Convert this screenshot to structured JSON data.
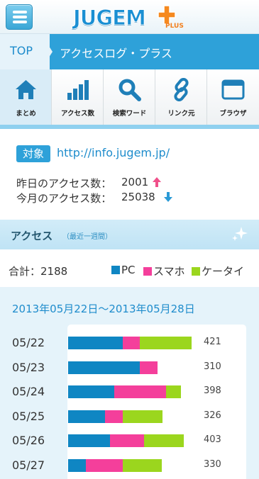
{
  "header": {
    "logo_text": "JUGEM",
    "logo_plus": "PLUS"
  },
  "breadcrumb": {
    "top": "TOP",
    "current": "アクセスログ・プラス"
  },
  "tabs": [
    {
      "label": "まとめ",
      "icon": "home-icon",
      "active": true
    },
    {
      "label": "アクセス数",
      "icon": "bar-chart-icon",
      "active": false
    },
    {
      "label": "検索ワード",
      "icon": "search-icon",
      "active": false
    },
    {
      "label": "リンク元",
      "icon": "link-icon",
      "active": false
    },
    {
      "label": "ブラウザ",
      "icon": "browser-window-icon",
      "active": false
    }
  ],
  "site": {
    "tag": "対象",
    "url": "http://info.jugem.jp/"
  },
  "stats": {
    "yesterday_label": "昨日のアクセス数：",
    "yesterday_value": "2001",
    "month_label": "今月のアクセス数：",
    "month_value": "25038"
  },
  "section": {
    "title": "アクセス",
    "subtitle": "（最近一週間）"
  },
  "summary": {
    "total": "合計：2188",
    "legend": [
      "PC",
      "スマホ",
      "ケータイ"
    ]
  },
  "colors": {
    "accent": "#2ea1d9",
    "pc": "#0f86c3",
    "smartphone": "#f43f9b",
    "mobile": "#9bd61e",
    "up_arrow": "#f0508a",
    "down_arrow": "#2a9ad6"
  },
  "chart_data": {
    "type": "bar",
    "title": "2013年05月22日～2013年05月28日",
    "categories": [
      "05/22",
      "05/23",
      "05/24",
      "05/25",
      "05/26",
      "05/27"
    ],
    "totals": [
      "421",
      "310",
      "398",
      "326",
      "403",
      "330"
    ],
    "series": [
      {
        "name": "PC",
        "values": [
          178,
          234,
          152,
          120,
          138,
          58
        ]
      },
      {
        "name": "スマホ",
        "values": [
          57,
          58,
          168,
          60,
          110,
          120
        ]
      },
      {
        "name": "ケータイ",
        "values": [
          170,
          0,
          50,
          130,
          130,
          130
        ]
      }
    ],
    "stacked": true
  }
}
